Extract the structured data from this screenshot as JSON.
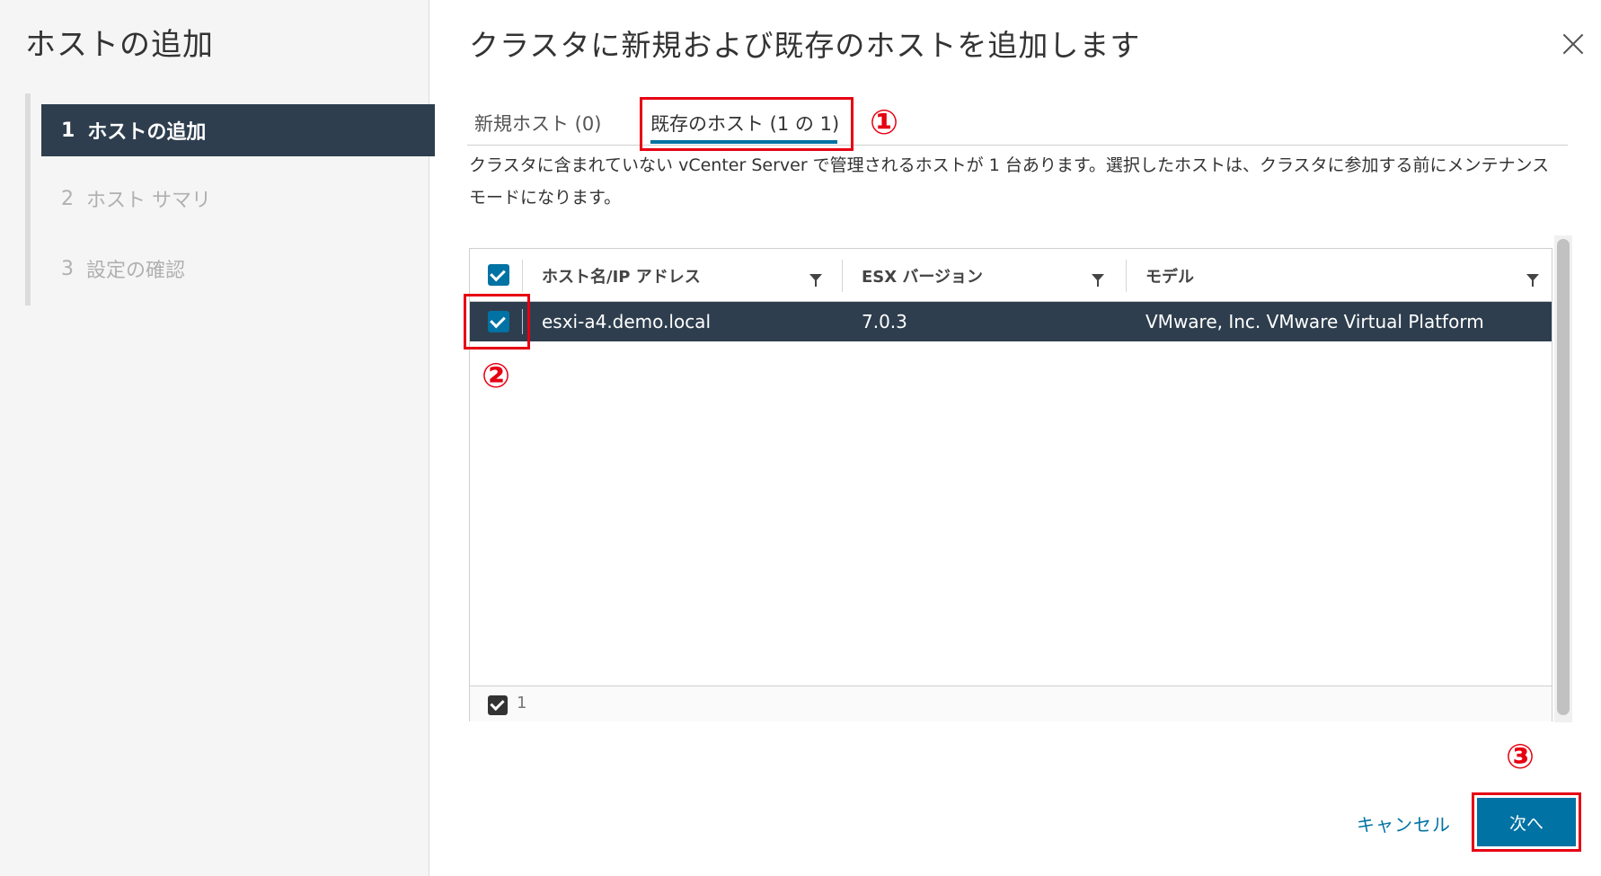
{
  "sidebar": {
    "title": "ホストの追加",
    "steps": [
      {
        "num": "1",
        "label": "ホストの追加"
      },
      {
        "num": "2",
        "label": "ホスト サマリ"
      },
      {
        "num": "3",
        "label": "設定の確認"
      }
    ]
  },
  "dialog": {
    "title": "クラスタに新規および既存のホストを追加します",
    "tabs": [
      {
        "label": "新規ホスト (0)"
      },
      {
        "label": "既存のホスト (1 の 1)"
      }
    ],
    "description": "クラスタに含まれていない vCenter Server で管理されるホストが 1 台あります。選択したホストは、クラスタに参加する前にメンテナンス モードになります。"
  },
  "grid": {
    "columns": [
      "ホスト名/IP アドレス",
      "ESX バージョン",
      "モデル"
    ],
    "rows": [
      {
        "host": "esxi-a4.demo.local",
        "version": "7.0.3",
        "model": "VMware, Inc. VMware Virtual Platform",
        "selected": true
      }
    ],
    "footer_count": "1"
  },
  "annotations": [
    "①",
    "②",
    "③"
  ],
  "buttons": {
    "cancel": "キャンセル",
    "next": "次へ"
  },
  "colors": {
    "accent": "#0072a3",
    "selected_row": "#2e3e4e",
    "annotation": "#e60012"
  }
}
